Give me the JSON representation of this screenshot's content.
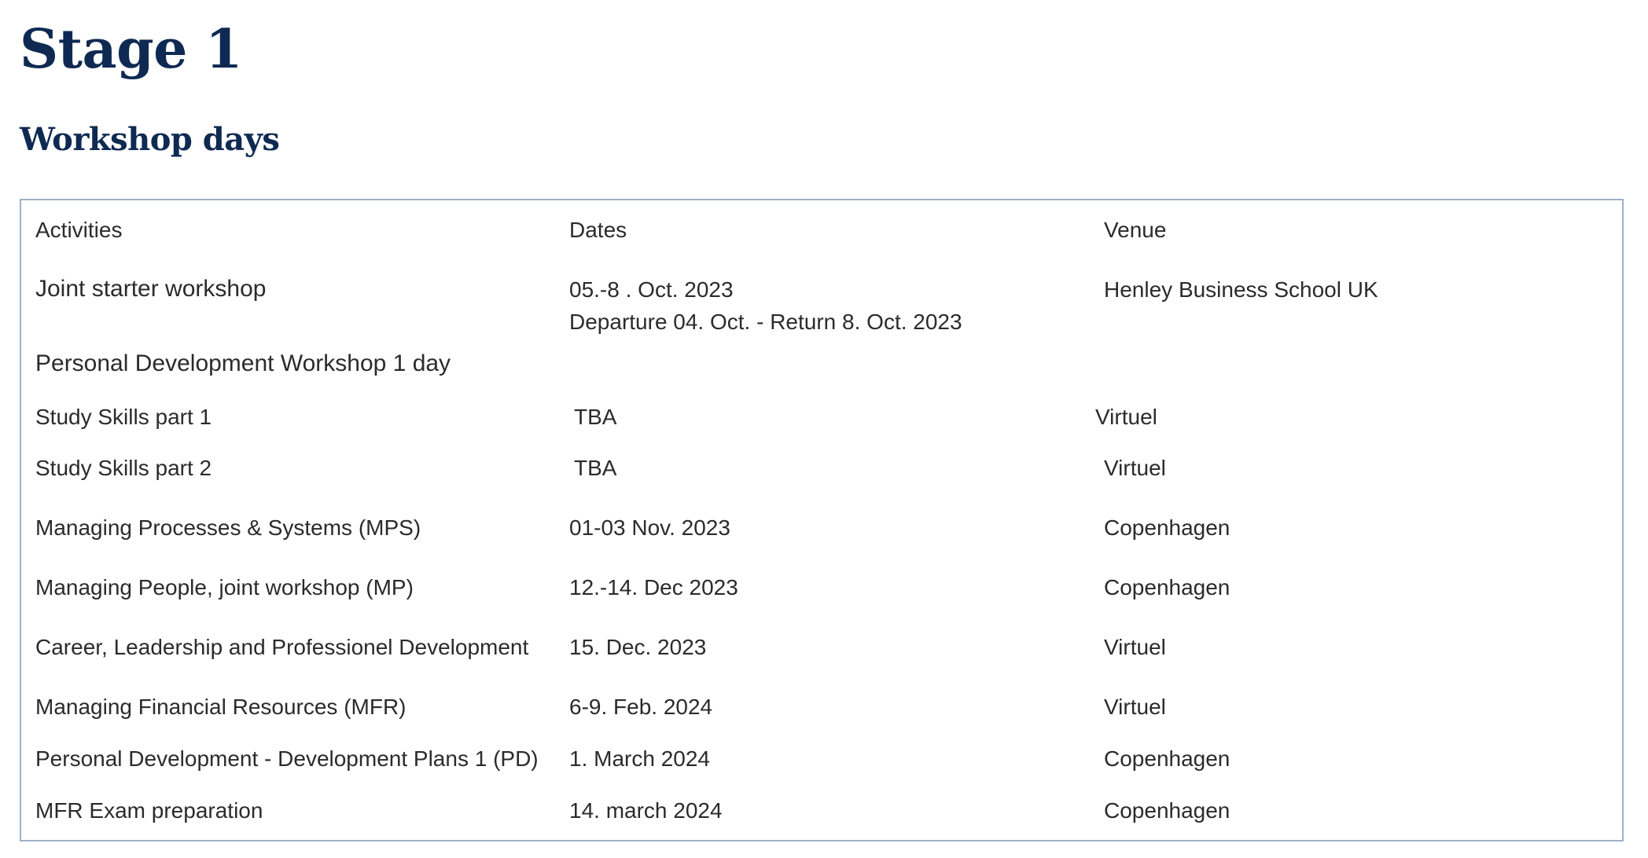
{
  "stage_title": "Stage 1",
  "section_title": "Workshop days",
  "table": {
    "headers": [
      "Activities",
      "Dates",
      "Venue"
    ],
    "rows": [
      {
        "activity": "Joint starter workshop",
        "date": "05.-8 . Oct. 2023",
        "date_note": "Departure 04. Oct. - Return 8. Oct. 2023",
        "venue": "Henley Business School UK"
      },
      {
        "activity": "Personal Development Workshop 1 day",
        "date": "",
        "venue": ""
      },
      {
        "activity": "Study Skills part 1",
        "date": "TBA",
        "venue": "Virtuel"
      },
      {
        "activity": "Study Skills part 2",
        "date": "TBA",
        "venue": "Virtuel"
      },
      {
        "activity": "Managing Processes & Systems (MPS)",
        "date": "01-03 Nov. 2023",
        "venue": "Copenhagen"
      },
      {
        "activity": "Managing People, joint workshop (MP)",
        "date": "12.-14. Dec 2023",
        "venue": "Copenhagen"
      },
      {
        "activity": "Career, Leadership and Professionel Development",
        "date": "15. Dec. 2023",
        "venue": "Virtuel"
      },
      {
        "activity": "Managing Financial Resources (MFR)",
        "date": "6-9.  Feb. 2024",
        "venue": "Virtuel"
      },
      {
        "activity": "Personal Development - Development Plans  1 (PD)",
        "date": "1.  March 2024",
        "venue": "Copenhagen"
      },
      {
        "activity": "MFR Exam preparation",
        "date": "14. march 2024",
        "venue": "Copenhagen"
      }
    ]
  }
}
